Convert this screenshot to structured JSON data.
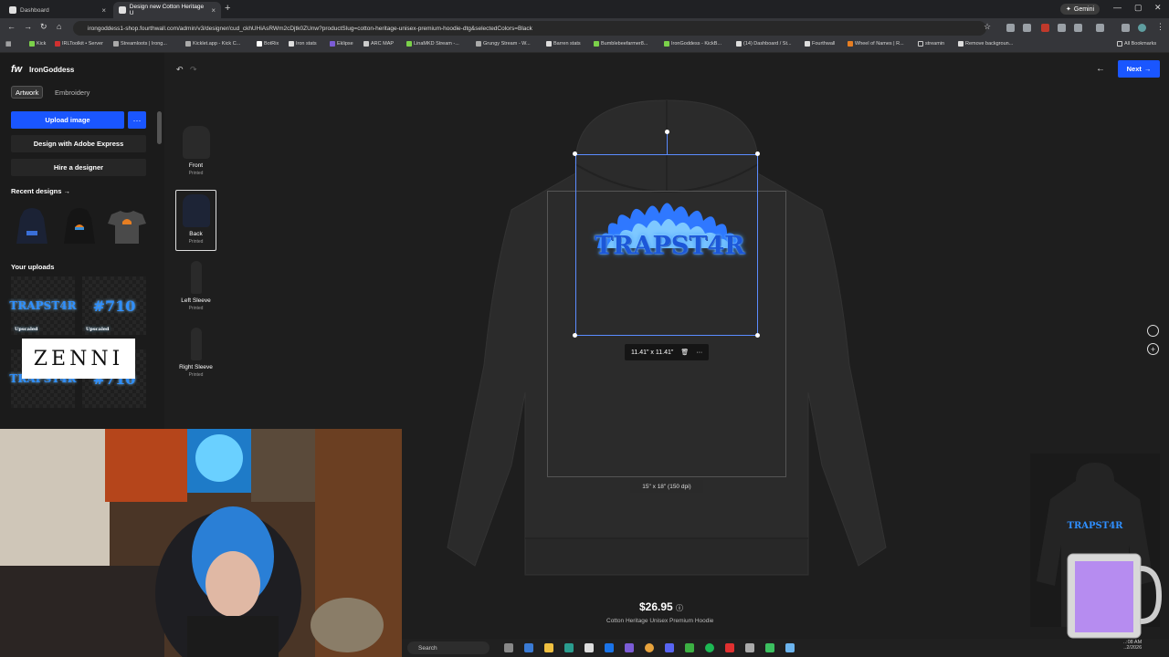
{
  "browser": {
    "tabs": [
      {
        "title": "Dashboard"
      },
      {
        "title": "Design new Cotton Heritage U"
      }
    ],
    "gemini_label": "Gemini",
    "url": "irongoddess1-shop.fourthwall.com/admin/v3/designer/cud_ckhUHiAsRWm2cDjtk0ZUnw?productSlug=cotton-heritage-unisex-premium-hoodie-dtg&selectedColors=Black",
    "bookmarks": [
      "Kick",
      "IRLToolkit • Server",
      "Streamloots | Irong...",
      "Kicklet.app - Kick C...",
      "BotRix",
      "Iron stats",
      "Eklipse",
      "ARC MAP",
      "LinaMKD Stream -...",
      "Grungy Stream - W...",
      "Barren stats",
      "Bumblebeefarmer8...",
      "IronGoddess - KickB...",
      "(14) Dashboard / St...",
      "Fourthwall",
      "Wheel of Names | R...",
      "streamin",
      "Remove backgroun..."
    ],
    "all_bookmarks": "All Bookmarks"
  },
  "sidebar": {
    "logo": "fw",
    "store_name": "IronGoddess",
    "tabs": [
      {
        "label": "Artwork",
        "active": true
      },
      {
        "label": "Embroidery",
        "active": false
      }
    ],
    "upload_label": "Upload image",
    "more_label": "···",
    "adobe_label": "Design with Adobe Express",
    "hire_label": "Hire a designer",
    "recent_label": "Recent designs →",
    "uploads_label": "Your uploads",
    "uploads": [
      {
        "text": "TRAPST4R",
        "badge": "Upscaled"
      },
      {
        "text": "#710",
        "badge": "Upscaled"
      },
      {
        "text": "TRAPST4R",
        "badge": ""
      },
      {
        "text": "#710",
        "badge": ""
      }
    ],
    "overlay_text": "ZENNI"
  },
  "views": [
    {
      "name": "Front",
      "sub": "Printed",
      "active": false
    },
    {
      "name": "Back",
      "sub": "Printed",
      "active": true
    },
    {
      "name": "Left Sleeve",
      "sub": "Printed",
      "active": false
    },
    {
      "name": "Right Sleeve",
      "sub": "Printed",
      "active": false
    }
  ],
  "canvas": {
    "design_text": "TRAPST4R",
    "selection_size": "11.41\" x 11.41\"",
    "print_area": "15\" x 18\" (150 dpi)",
    "price": "$26.95",
    "product_name": "Cotton Heritage Unisex Premium Hoodie",
    "next_label": "Next",
    "preview_text": "TRAPST4R",
    "garment_color": "#2b2b2b",
    "accent": "#1a56ff"
  },
  "taskbar": {
    "search_label": "Search",
    "clock": "..:08 AM",
    "date": "..2/2026"
  }
}
